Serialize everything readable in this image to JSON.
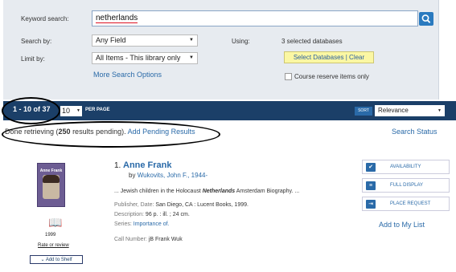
{
  "search": {
    "keyword_label": "Keyword search:",
    "keyword_value": "netherlands",
    "search_by_label": "Search by:",
    "search_by_value": "Any Field",
    "limit_by_label": "Limit by:",
    "limit_by_value": "All Items - This library only",
    "using_label": "Using:",
    "databases_text": "3 selected databases",
    "select_databases": "Select Databases",
    "clear": "Clear",
    "more_options": "More Search Options",
    "course_reserve": "Course reserve items only"
  },
  "results_bar": {
    "count": "1 - 10 of 37",
    "per_page_value": "10",
    "per_page_label": "PER PAGE",
    "sort_label": "SORT",
    "sort_value": "Relevance"
  },
  "status": {
    "prefix": "Done retrieving (",
    "pending_count": "250",
    "suffix": " results pending).",
    "add_pending": "Add Pending Results",
    "search_status": "Search Status"
  },
  "result": {
    "number": "1.",
    "title": "Anne Frank",
    "by": "by",
    "author": "Wukovits, John F., 1944-",
    "snippet_pre": "... Jewish children in the Holocaust ",
    "snippet_highlight": "Netherlands",
    "snippet_post": " Amsterdam Biography. ...",
    "publisher_label": "Publisher, Date:",
    "publisher_value": "San Diego, CA : Lucent Books, 1999.",
    "description_label": "Description:",
    "description_value": "96 p. : ill. ; 24 cm.",
    "series_label": "Series:",
    "series_value": "Importance of.",
    "call_number_label": "Call Number:",
    "call_number_value": "jB Frank Wuk",
    "cover_title": "Anne Frank",
    "year": "1999",
    "rate_review": "Rate or review",
    "add_to_shelf": "Add to Shelf",
    "actions": {
      "availability": "AVAILABILITY",
      "full_display": "FULL DISPLAY",
      "place_request": "PLACE REQUEST"
    },
    "add_to_my_list": "Add to My List"
  }
}
